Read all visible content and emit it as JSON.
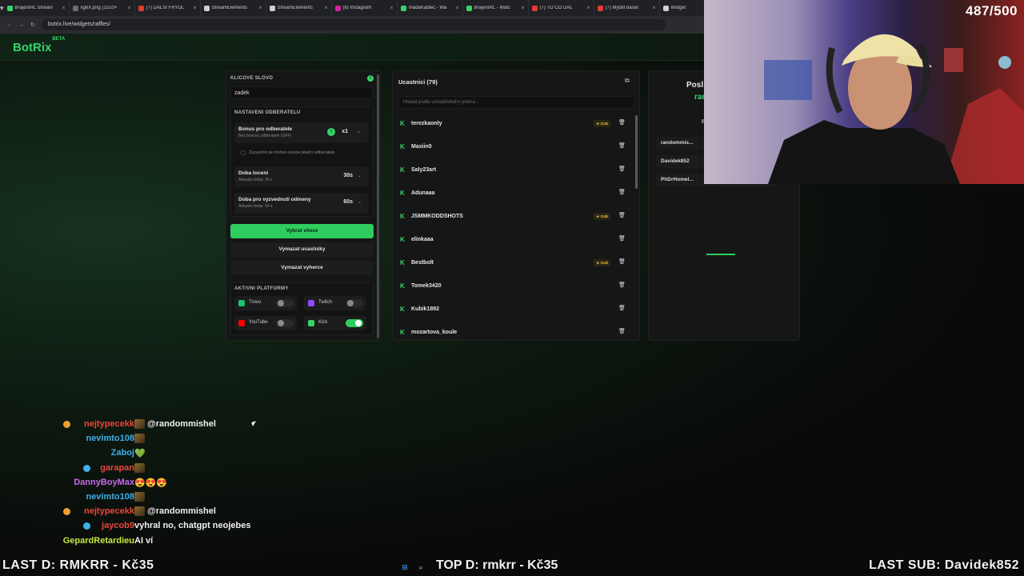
{
  "browser": {
    "tabs": [
      {
        "label": "BrajenIRL Stream",
        "color": "#35d46a"
      },
      {
        "label": "kg6X.png (1510×",
        "color": "#6e6e6e"
      },
      {
        "label": "(7) DALŠÍ FRÝDL",
        "color": "#e53935"
      },
      {
        "label": "StreamElements",
        "color": "#cfcfcf"
      },
      {
        "label": "StreamElements",
        "color": "#cfcfcf"
      },
      {
        "label": "(8) Instagram",
        "color": "#d6249f"
      },
      {
        "label": "VladaKadlec - Wa",
        "color": "#35d46a"
      },
      {
        "label": "BrajenIRL - Watc",
        "color": "#35d46a"
      },
      {
        "label": "(7) TO ČO DAL",
        "color": "#e53935"
      },
      {
        "label": "(7) Mýdlíl baran",
        "color": "#e53935"
      },
      {
        "label": "Widget",
        "color": "#cfcfcf"
      }
    ],
    "url": "botrix.live/widgets/raffles/"
  },
  "app": {
    "logo": "BotRix",
    "beta": "BETA"
  },
  "settings": {
    "keyword_label": "KLICOVE SLOVO",
    "keyword_value": "zadek",
    "subs_label": "NASTAVENI ODBERATELU",
    "bonus_title": "Bonus pro odberatele",
    "bonus_sub": "Bez bonusu odberatele (OFF)",
    "bonus_value": "x1",
    "subs_only": "Zucastnit se mohou pouze platici odberatele",
    "spin_title": "Doba toceni",
    "spin_sub": "Aktualni doba: 30 s",
    "spin_value": "30s",
    "claim_title": "Doba pro vyzvednuti odmeny",
    "claim_sub": "Aktualni doba: 60 s",
    "claim_value": "60s",
    "pick_winner": "Vybrat viteze",
    "clear_participants": "Vymazat ucastniky",
    "clear_winners": "Vymazat vyherce",
    "platforms_label": "AKTIVNI PLATFORMY",
    "platforms": [
      {
        "name": "Trovo",
        "on": false,
        "color": "#1fbf73"
      },
      {
        "name": "Twitch",
        "on": false,
        "color": "#9146ff"
      },
      {
        "name": "YouTube",
        "on": false,
        "color": "#ff0000"
      },
      {
        "name": "Kick",
        "on": true,
        "color": "#35d46a"
      }
    ]
  },
  "participants": {
    "title": "Ucastnici (79)",
    "search_placeholder": "Hledat podle uzivatelskeho jmena...",
    "sub_badge": "SUB",
    "list": [
      {
        "name": "terezkaonly",
        "sub": true
      },
      {
        "name": "Maxiin0",
        "sub": false
      },
      {
        "name": "Saly23art",
        "sub": false
      },
      {
        "name": "Adunaaa",
        "sub": false
      },
      {
        "name": "JSMMKODDSHOTS",
        "sub": true
      },
      {
        "name": "elinkaaa",
        "sub": false
      },
      {
        "name": "Bestbolt",
        "sub": true
      },
      {
        "name": "Tomek3420",
        "sub": false
      },
      {
        "name": "Kubik1892",
        "sub": false
      },
      {
        "name": "mozartova_koule",
        "sub": false
      }
    ]
  },
  "winners": {
    "title": "Posl",
    "subtitle": "ran",
    "col": "P",
    "list": [
      "randommis...",
      "Davidek852",
      "PhDrHomel..."
    ]
  },
  "stream": {
    "counter": "487/500",
    "last_d": "LAST D: RMKRR - Kč35",
    "top_d": "TOP D: rmkrr - Kč35",
    "last_sub": "LAST SUB: Davidek852"
  },
  "chat": [
    {
      "user": "nejtypecekk",
      "color": "#e8473c",
      "badge": "#f0a030",
      "emote": true,
      "msg": "@randommishel"
    },
    {
      "user": "nevimto108",
      "color": "#3fb0e8",
      "badge": "",
      "emote": true,
      "msg": ""
    },
    {
      "user": "Zaboj",
      "color": "#3fb0e8",
      "badge": "",
      "emote": false,
      "msg": "💚"
    },
    {
      "user": "garapan",
      "color": "#e8473c",
      "badge": "#3fb0e8",
      "emote": true,
      "msg": ""
    },
    {
      "user": "DannyBoyMax",
      "color": "#c86ae8",
      "badge": "",
      "emote": false,
      "msg": "😍😍😍"
    },
    {
      "user": "nevimto108",
      "color": "#3fb0e8",
      "badge": "",
      "emote": true,
      "msg": ""
    },
    {
      "user": "nejtypecekk",
      "color": "#e8473c",
      "badge": "#f0a030",
      "emote": true,
      "msg": "@randommishel"
    },
    {
      "user": "jaycob9",
      "color": "#e8473c",
      "badge": "#3fb0e8",
      "emote": false,
      "msg": "vyhral no, chatgpt neojebes"
    },
    {
      "user": "GepardRetardieu",
      "color": "#c8e83f",
      "badge": "",
      "emote": false,
      "msg": "AI ví"
    }
  ]
}
